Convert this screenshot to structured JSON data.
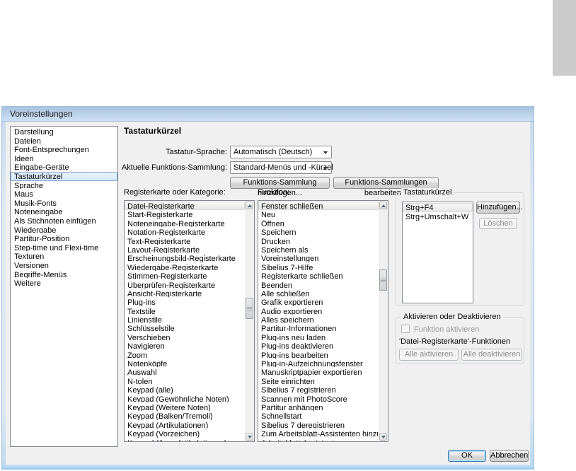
{
  "window": {
    "title": "Voreinstellungen"
  },
  "sidebar": {
    "items": [
      "Darstellung",
      "Dateien",
      "Font-Entsprechungen",
      "Ideen",
      "Eingabe-Geräte",
      "Tastaturkürzel",
      "Sprache",
      "Maus",
      "Musik-Fonts",
      "Noteneingabe",
      "Als Stichnoten einfügen",
      "Wiedergabe",
      "Partitur-Position",
      "Step-time und Flexi-time",
      "Texturen",
      "Versionen",
      "Begriffe-Menüs",
      "Weitere"
    ],
    "selected_index": 5
  },
  "header": {
    "title": "Tastaturkürzel"
  },
  "form": {
    "language_label": "Tastatur-Sprache:",
    "language_value": "Automatisch (Deutsch)",
    "featureset_label": "Aktuelle Funktions-Sammlung:",
    "featureset_value": "Standard-Menüs und -Kürzel",
    "add_set_button": "Funktions-Sammlung hinzufügen...",
    "edit_sets_button": "Funktions-Sammlungen bearbeiten..."
  },
  "category_list": {
    "label": "Registerkarte oder Kategorie:",
    "selected_index": 0,
    "items": [
      "Datei-Registerkarte",
      "Start-Registerkarte",
      "Noteneingabe-Registerkarte",
      "Notation-Registerkarte",
      "Text-Registerkarte",
      "Layout-Registerkarte",
      "Erscheinungsbild-Registerkarte",
      "Wiedergabe-Registerkarte",
      "Stimmen-Registerkarte",
      "Überprüfen-Registerkarte",
      "Ansicht-Registerkarte",
      "Plug-ins",
      "Textstile",
      "Linienstile",
      "Schlüsselstile",
      "Verschieben",
      "Navigieren",
      "Zoom",
      "Notenköpfe",
      "Auswahl",
      "N-tolen",
      "Keypad (alle)",
      "Keypad (Gewöhnliche Noten)",
      "Keypad (Weitere Noten)",
      "Keypad (Balken/Tremoli)",
      "Keypad (Artikulationen)",
      "Keypad (Vorzeichen)",
      "Keypad (Jazz-Artikulationen)"
    ]
  },
  "function_list": {
    "label": "Funktion:",
    "selected_index": 0,
    "items": [
      "Fenster schließen",
      "Neu",
      "Öffnen",
      "Speichern",
      "Drucken",
      "Speichern als",
      "Voreinstellungen",
      "Sibelius 7-Hilfe",
      "Registerkarte schließen",
      "Beenden",
      "Alle schließen",
      "Grafik exportieren",
      "Audio exportieren",
      "Alles speichern",
      "Partitur-Informationen",
      "Plug-ins neu laden",
      "Plug-ins deaktivieren",
      "Plug-ins bearbeiten",
      "Plug-in-Aufzeichnungsfenster",
      "Manuskriptpapier exportieren",
      "Seite einrichten",
      "Sibelius 7 registrieren",
      "Scannen mit PhotoScore",
      "Partitur anhängen",
      "Schnellstart",
      "Sibelius 7 deregistrieren",
      "Zum Arbeitsblatt-Assistenten hinzufügen",
      "Arbeitsblatt-Assistent"
    ]
  },
  "shortcuts": {
    "group_label": "Tastaturkürzel",
    "items": [
      "Strg+F4",
      "Strg+Umschalt+W"
    ],
    "selected_index": 0,
    "add_button": "Hinzufügen...",
    "delete_button": "Löschen"
  },
  "enable": {
    "group_label": "Aktivieren oder Deaktivieren",
    "checkbox_label": "Funktion aktivieren",
    "checkbox_checked": false,
    "context_label": "'Datei-Registerkarte'-Funktionen",
    "enable_all_button": "Alle aktivieren",
    "disable_all_button": "Alle deaktivieren"
  },
  "footer": {
    "ok": "OK",
    "cancel": "Abbrechen"
  },
  "colors": {
    "frame_accent": "#9fcdf0",
    "selection_border": "#84a8d9",
    "dialog_bg": "#f0f0f0"
  }
}
